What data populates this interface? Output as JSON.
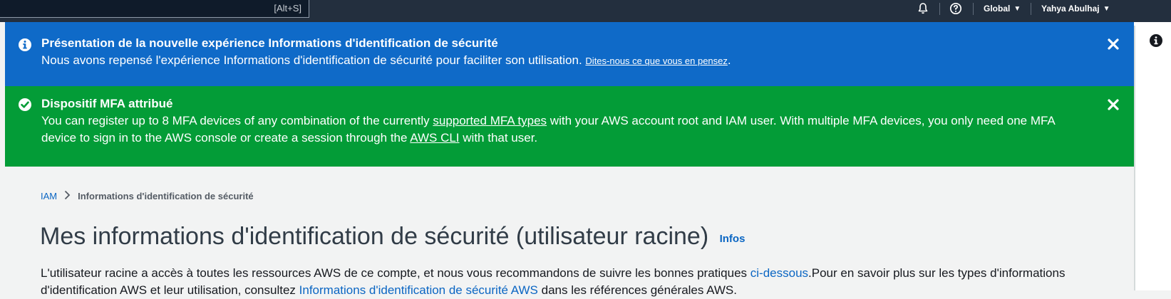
{
  "topnav": {
    "search_shortcut": "[Alt+S]",
    "region_label": "Global",
    "user_label": "Yahya Abulhaj"
  },
  "flash_intro": {
    "title": "Présentation de la nouvelle expérience Informations d'identification de sécurité",
    "body": "Nous avons repensé l'expérience Informations d'identification de sécurité pour faciliter son utilisation.",
    "link": "Dites-nous ce que vous en pensez",
    "tail": "."
  },
  "flash_mfa": {
    "title": "Dispositif MFA attribué",
    "body_1": "You can register up to 8 MFA devices of any combination of the currently",
    "link_1": "supported MFA types",
    "body_2": "with your AWS account root and IAM user. With multiple MFA devices, you only need one MFA device to sign in to the AWS console or create a session through the",
    "link_2": "AWS CLI",
    "body_3": "with that user."
  },
  "breadcrumb": {
    "root": "IAM",
    "current": "Informations d'identification de sécurité"
  },
  "page": {
    "title": "Mes informations d'identification de sécurité (utilisateur racine)",
    "info_link": "Infos",
    "desc_1": "L'utilisateur racine a accès à toutes les ressources AWS de ce compte, et nous vous recommandons de suivre les bonnes pratiques",
    "desc_link_1": "ci-dessous",
    "desc_2": ".Pour en savoir plus sur les types d'informations d'identification AWS et leur utilisation, consultez",
    "desc_link_2": "Informations d'identification de sécurité AWS",
    "desc_3": "dans les références générales AWS."
  },
  "colors": {
    "nav_bg": "#232f3e",
    "info_blue": "#0f6ac8",
    "success_green": "#039c37",
    "link_blue": "#0b66c3"
  }
}
